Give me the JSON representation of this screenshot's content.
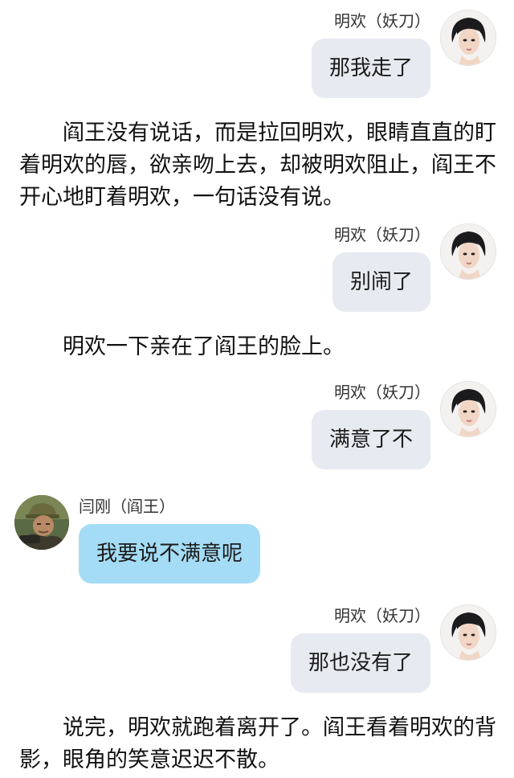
{
  "messages": [
    {
      "side": "right",
      "sender": "明欢（妖刀）",
      "text": "那我走了"
    },
    {
      "side": "right",
      "sender": "明欢（妖刀）",
      "text": "别闹了"
    },
    {
      "side": "right",
      "sender": "明欢（妖刀）",
      "text": "满意了不"
    },
    {
      "side": "left",
      "sender": "闫刚（阎王）",
      "text": "我要说不满意呢"
    },
    {
      "side": "right",
      "sender": "明欢（妖刀）",
      "text": "那也没有了"
    }
  ],
  "narrations": [
    "　　阎王没有说话，而是拉回明欢，眼睛直直的盯着明欢的唇，欲亲吻上去，却被明欢阻止，阎王不开心地盯着明欢，一句话没有说。",
    "　　明欢一下亲在了阎王的脸上。",
    "　　说完，明欢就跑着离开了。阎王看着明欢的背影，眼角的笑意迟迟不散。"
  ],
  "colors": {
    "right_bubble": "#e7eaf0",
    "left_bubble": "#a5dcf5",
    "background": "#ffffff"
  },
  "avatars": {
    "right": "girl-portrait-avatar",
    "left": "man-in-cap-avatar"
  }
}
